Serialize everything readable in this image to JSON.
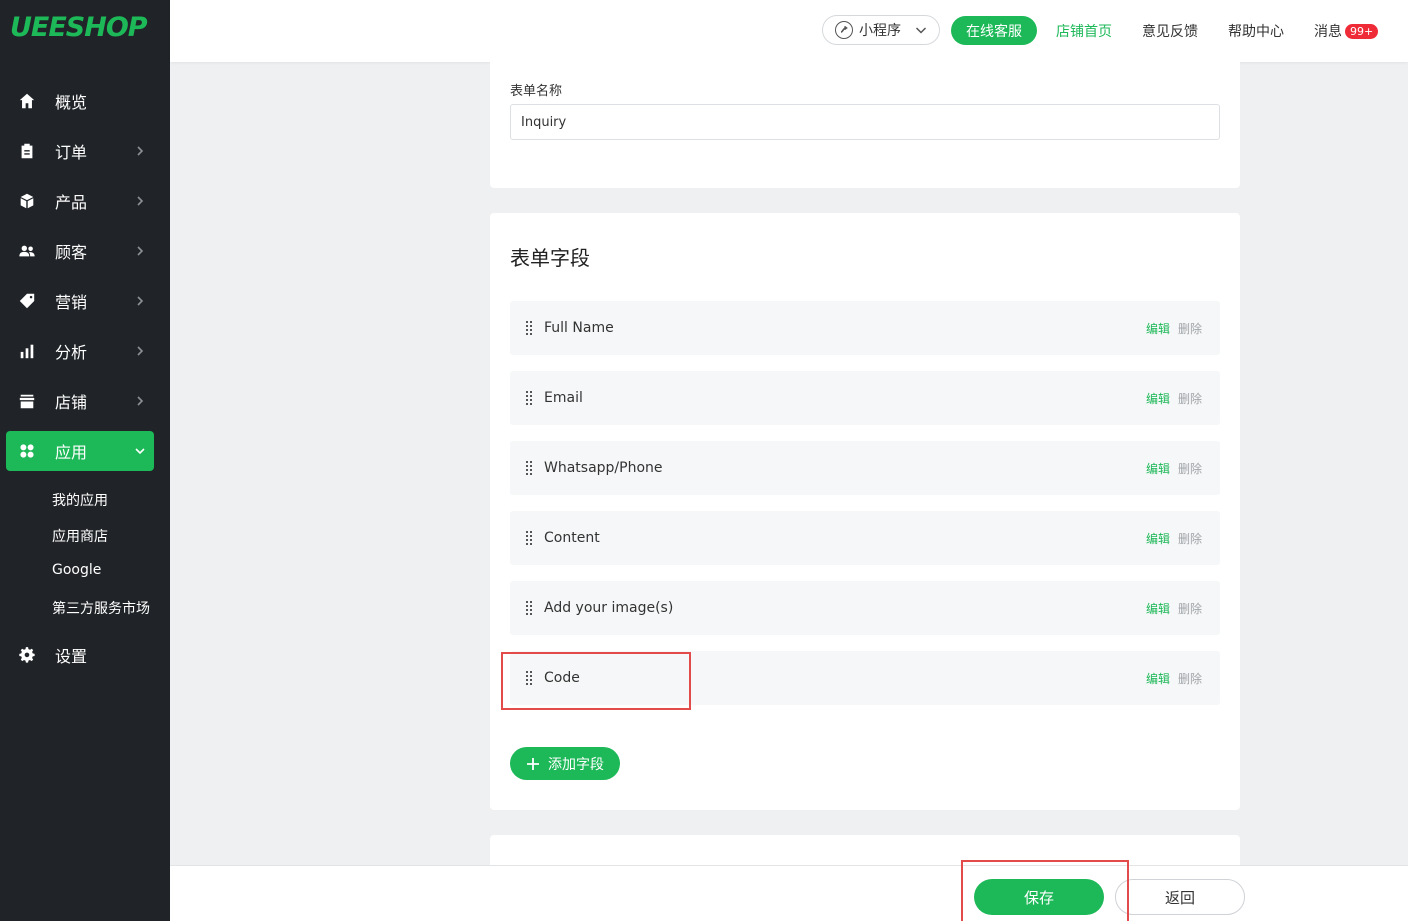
{
  "brand": {
    "logo": "UEESHOP",
    "accent": "#1db858"
  },
  "sidebar": {
    "items": [
      {
        "label": "概览",
        "icon": "home-icon"
      },
      {
        "label": "订单",
        "icon": "clipboard-icon"
      },
      {
        "label": "产品",
        "icon": "box-icon"
      },
      {
        "label": "顾客",
        "icon": "users-icon"
      },
      {
        "label": "营销",
        "icon": "tag-icon"
      },
      {
        "label": "分析",
        "icon": "bar-chart-icon"
      },
      {
        "label": "店铺",
        "icon": "store-icon"
      },
      {
        "label": "应用",
        "icon": "apps-icon"
      },
      {
        "label": "设置",
        "icon": "gear-icon"
      }
    ],
    "sub_items": [
      "我的应用",
      "应用商店",
      "Google",
      "第三方服务市场"
    ]
  },
  "header": {
    "mini_program": "小程序",
    "online_service": "在线客服",
    "links": [
      "店铺首页",
      "意见反馈",
      "帮助中心",
      "消息"
    ],
    "message_badge": "99+"
  },
  "form": {
    "name_label": "表单名称",
    "name_value": "Inquiry",
    "fields_title": "表单字段",
    "fields": [
      "Full Name",
      "Email",
      "Whatsapp/Phone",
      "Content",
      "Add your image(s)",
      "Code"
    ],
    "edit_label": "编辑",
    "delete_label": "删除",
    "add_field_label": "添加字段"
  },
  "footer": {
    "save_label": "保存",
    "back_label": "返回"
  }
}
